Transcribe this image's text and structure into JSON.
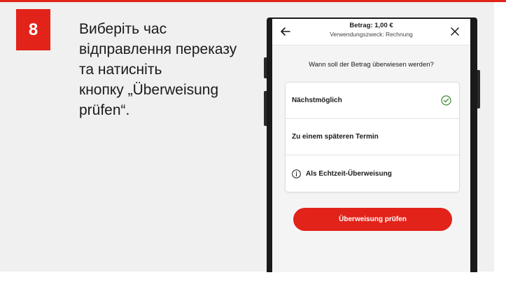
{
  "step": {
    "number": "8",
    "instruction_lines": [
      "Виберіть час",
      "відправлення переказу",
      "та натисніть",
      "кнопку „Überweisung",
      "prüfen“."
    ]
  },
  "app": {
    "header": {
      "title": "Betrag: 1,00 €",
      "subtitle": "Verwendungszweck: Rechnung",
      "back_icon": "arrow-left-icon",
      "close_icon": "close-icon"
    },
    "question": "Wann soll der Betrag überwiesen werden?",
    "options": [
      {
        "label": "Nächstmöglich",
        "selected": true,
        "icon": "check-circle-icon"
      },
      {
        "label": "Zu einem späteren Termin",
        "selected": false
      },
      {
        "label": "Als Echtzeit-Überweisung",
        "selected": false,
        "icon": "info-icon"
      }
    ],
    "primary_button": "Überweisung prüfen"
  },
  "colors": {
    "accent": "#e2231a",
    "check": "#3a8a2e",
    "panel": "#f0f0f0"
  }
}
